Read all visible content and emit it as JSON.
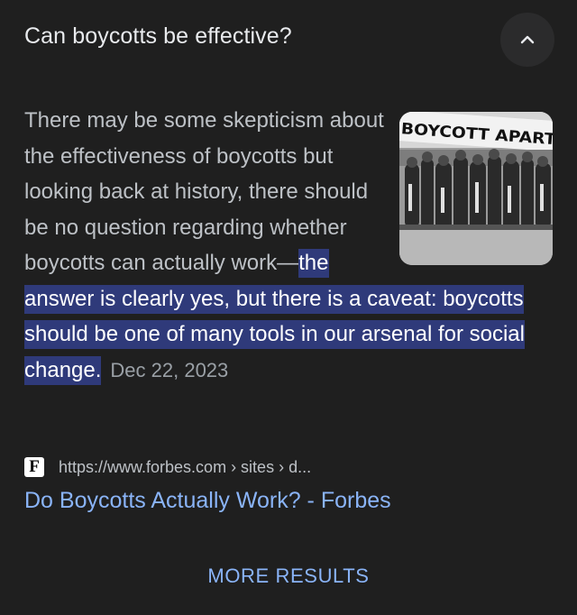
{
  "question": {
    "text": "Can boycotts be effective?",
    "toggle_icon": "chevron-up-icon"
  },
  "answer": {
    "text_plain": "There may be some skepticism about the effectiveness of boycotts but looking back at history, there should be no question regarding whether boycotts can actually work—",
    "text_highlighted": "the answer is clearly yes, but there is a caveat: boycotts should be one of many tools in our arsenal for social change.",
    "date": "Dec 22, 2023",
    "image": {
      "sign_text": "BOYCOTT APART"
    }
  },
  "source": {
    "favicon_letter": "F",
    "url": "https://www.forbes.com › sites › d...",
    "title": "Do Boycotts Actually Work? - Forbes"
  },
  "footer": {
    "more_results_label": "MORE RESULTS"
  },
  "colors": {
    "background": "#1f1f1f",
    "highlight": "#2f3a7a",
    "link": "#8ab4f8"
  }
}
